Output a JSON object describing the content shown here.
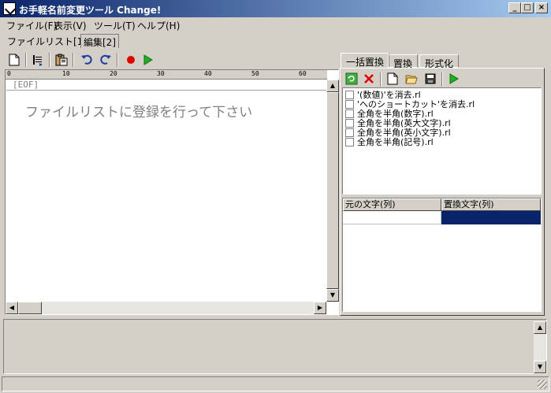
{
  "window": {
    "title": "お手軽名前変更ツール Change!",
    "minimize_label": "_",
    "maximize_label": "□",
    "close_label": "×"
  },
  "menu": {
    "items": [
      "ファイル(F)",
      "表示(V)",
      "ツール(T)",
      "ヘルプ(H)"
    ]
  },
  "doc_tabs": {
    "items": [
      "ファイルリスト[1]",
      "編集[2]"
    ],
    "active_index": 1
  },
  "toolbar": {
    "icons": [
      "new-file-icon",
      "insert-icon",
      "paste-icon",
      "undo-icon",
      "redo-icon",
      "record-icon",
      "play-icon"
    ]
  },
  "editor": {
    "ruler_labels": [
      "0",
      "10",
      "20",
      "30",
      "40",
      "50",
      "60"
    ],
    "eof_marker": "[EOF]",
    "placeholder": "ファイルリストに登録を行って下さい"
  },
  "right_panel": {
    "tabs": [
      "一括置換",
      "置換",
      "形式化"
    ],
    "active_tab_index": 0,
    "toolbar_icons": [
      "refresh-icon",
      "delete-icon",
      "new-file-icon",
      "open-folder-icon",
      "save-icon",
      "play-icon"
    ],
    "rules": [
      "'(数値)'を消去.rl",
      "'へのショートカット'を消去.rl",
      "全角を半角(数字).rl",
      "全角を半角(英大文字).rl",
      "全角を半角(英小文字).rl",
      "全角を半角(記号).rl"
    ],
    "table": {
      "columns": [
        "元の文字(列)",
        "置換文字(列)"
      ]
    }
  },
  "colors": {
    "title_gradient_start": "#0a246a",
    "title_gradient_end": "#a6caf0",
    "selected_cell": "#0a246a",
    "face": "#d4d0c8"
  }
}
